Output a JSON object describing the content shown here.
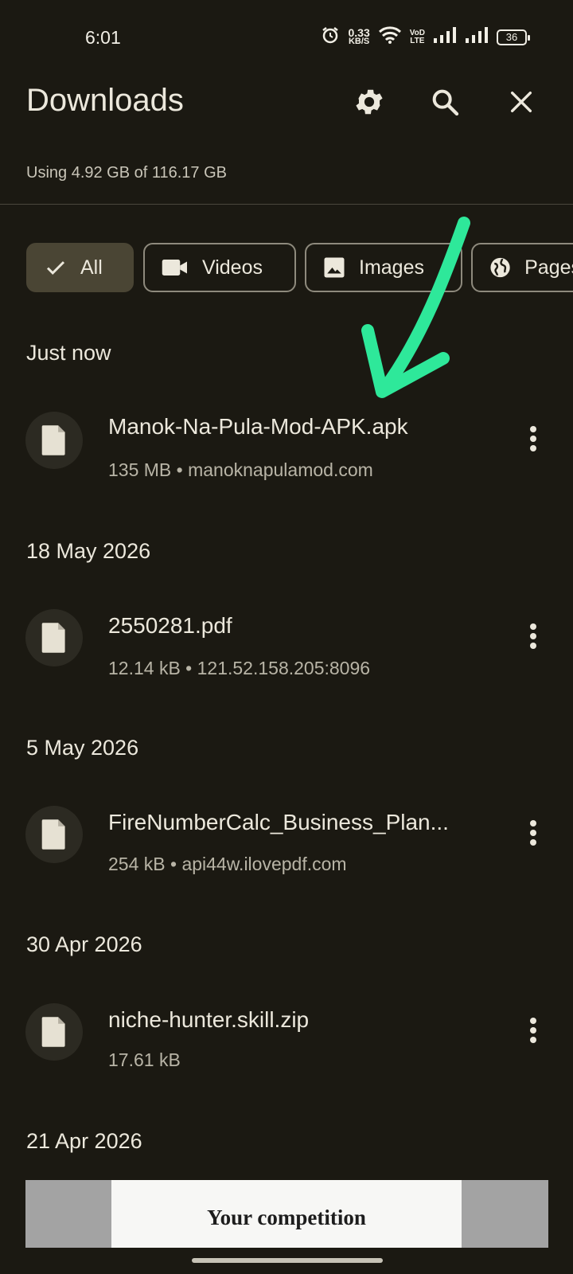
{
  "status_bar": {
    "time": "6:01",
    "net_speed_value": "0.33",
    "net_speed_unit": "KB/S",
    "volte_top": "VoD",
    "volte_bottom": "LTE",
    "battery": "36"
  },
  "header": {
    "title": "Downloads",
    "storage_usage": "Using 4.92 GB of 116.17 GB"
  },
  "filters": [
    {
      "label": "All",
      "selected": true,
      "icon": "check-icon"
    },
    {
      "label": "Videos",
      "selected": false,
      "icon": "video-icon"
    },
    {
      "label": "Images",
      "selected": false,
      "icon": "image-icon"
    },
    {
      "label": "Pages",
      "selected": false,
      "icon": "globe-icon"
    }
  ],
  "sections": [
    {
      "heading": "Just now",
      "items": [
        {
          "name": "Manok-Na-Pula-Mod-APK.apk",
          "meta": "135 MB • manoknapulamod.com"
        }
      ]
    },
    {
      "heading": "18 May 2026",
      "items": [
        {
          "name": "2550281.pdf",
          "meta": "12.14 kB • 121.52.158.205:8096"
        }
      ]
    },
    {
      "heading": "5 May 2026",
      "items": [
        {
          "name": "FireNumberCalc_Business_Plan...",
          "meta": "254 kB • api44w.ilovepdf.com"
        }
      ]
    },
    {
      "heading": "30 Apr 2026",
      "items": [
        {
          "name": "niche-hunter.skill.zip",
          "meta": "17.61 kB"
        }
      ]
    },
    {
      "heading": "21 Apr 2026",
      "items": [
        {
          "thumbnail_text": "Your competition"
        }
      ]
    }
  ],
  "colors": {
    "background": "#1b1912",
    "selected_chip": "#4a4534",
    "annotation_arrow": "#2ee89a"
  }
}
